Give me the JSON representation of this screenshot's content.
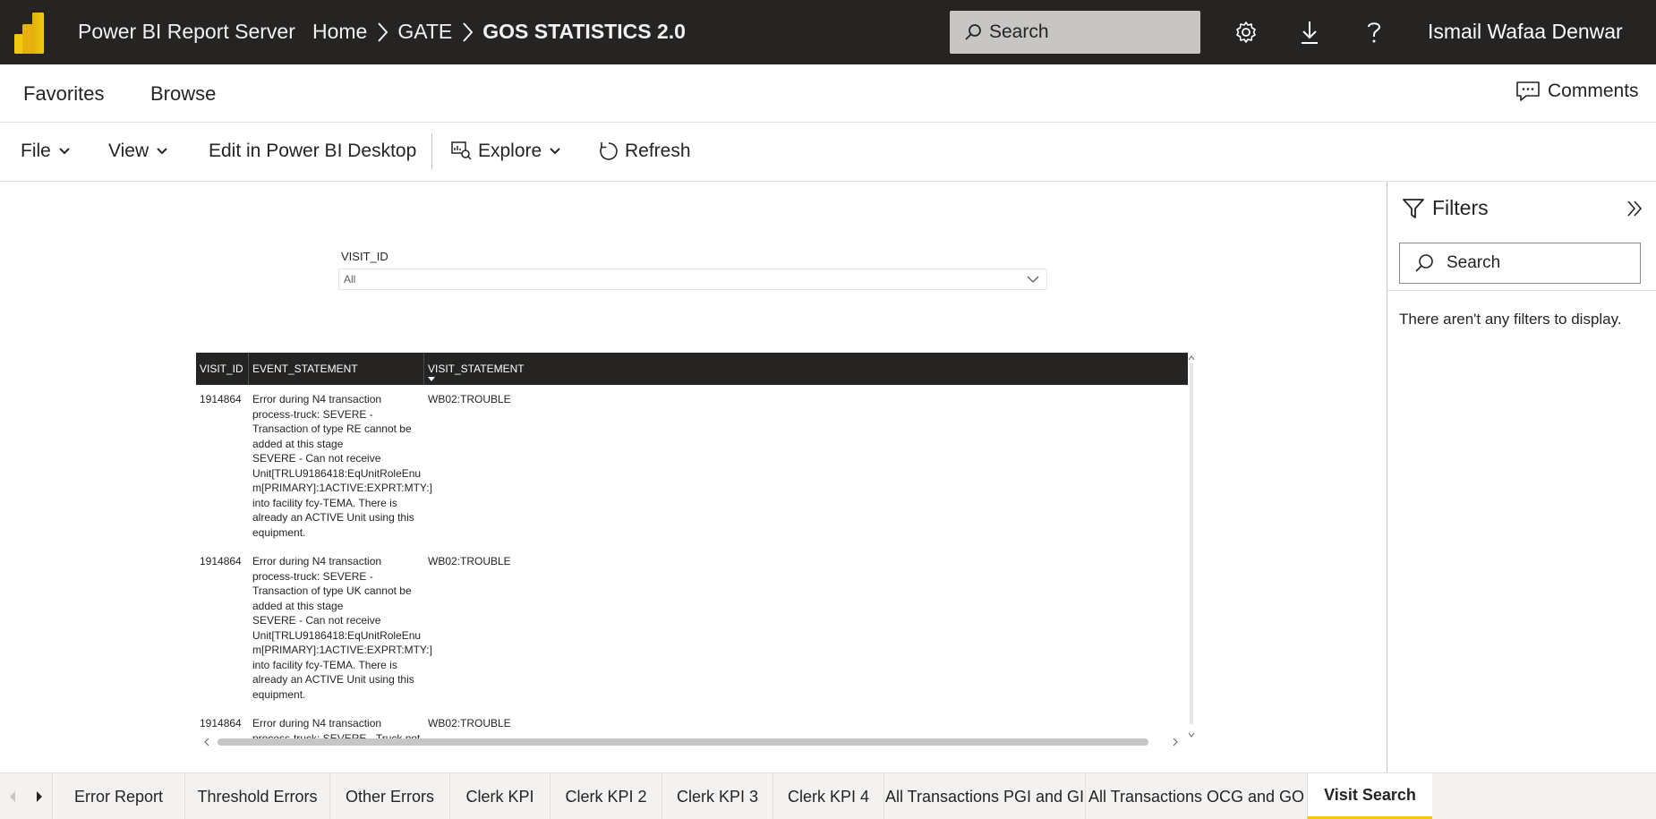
{
  "header": {
    "app_title": "Power BI Report Server",
    "breadcrumbs": [
      "Home",
      "GATE",
      "GOS STATISTICS 2.0"
    ],
    "search_placeholder": "Search",
    "user_name": "Ismail Wafaa Denwar",
    "icons": [
      "powerbi-logo",
      "search-icon",
      "settings-gear-icon",
      "download-icon",
      "help-icon"
    ]
  },
  "nav": {
    "favorites": "Favorites",
    "browse": "Browse",
    "comments": "Comments"
  },
  "toolbar": {
    "file": "File",
    "view": "View",
    "edit_desktop": "Edit in Power BI Desktop",
    "explore": "Explore",
    "refresh": "Refresh"
  },
  "slicer": {
    "title": "VISIT_ID",
    "value": "All"
  },
  "table": {
    "columns": [
      "VISIT_ID",
      "EVENT_STATEMENT",
      "VISIT_STATEMENT"
    ],
    "rows": [
      {
        "visit_id": "1914864",
        "event_lines": [
          "Error during N4 transaction",
          "process-truck: SEVERE -",
          "Transaction of type RE cannot be",
          "added at this stage",
          "SEVERE - Can not receive",
          "Unit[TRLU9186418:EqUnitRoleEnu",
          "m[PRIMARY]:1ACTIVE:EXPRT:MTY:]",
          "into facility fcy-TEMA. There is",
          "already an ACTIVE Unit using this",
          "equipment."
        ],
        "visit_statement": "WB02:TROUBLE"
      },
      {
        "visit_id": "1914864",
        "event_lines": [
          "Error during N4 transaction",
          "process-truck: SEVERE -",
          "Transaction of type UK cannot be",
          "added at this stage",
          "SEVERE - Can not receive",
          "Unit[TRLU9186418:EqUnitRoleEnu",
          "m[PRIMARY]:1ACTIVE:EXPRT:MTY:]",
          "into facility fcy-TEMA. There is",
          "already an ACTIVE Unit using this",
          "equipment."
        ],
        "visit_statement": "WB02:TROUBLE"
      },
      {
        "visit_id": "1914864",
        "event_lines": [
          "Error during N4 transaction",
          "process-truck: SEVERE - Truck not"
        ],
        "visit_statement": "WB02:TROUBLE"
      }
    ]
  },
  "filters": {
    "title": "Filters",
    "search_placeholder": "Search",
    "empty_message": "There aren't any filters to display."
  },
  "page_tabs": {
    "items": [
      "Error Report",
      "Threshold Errors",
      "Other Errors",
      "Clerk KPI",
      "Clerk KPI 2",
      "Clerk KPI 3",
      "Clerk KPI 4",
      "All Transactions PGI and GI",
      "All Transactions OCG and GO",
      "Visit Search"
    ],
    "active": "Visit Search"
  },
  "colors": {
    "header_bg": "#252423",
    "accent_yellow": "#f2c811",
    "table_header_bg": "#252423"
  }
}
